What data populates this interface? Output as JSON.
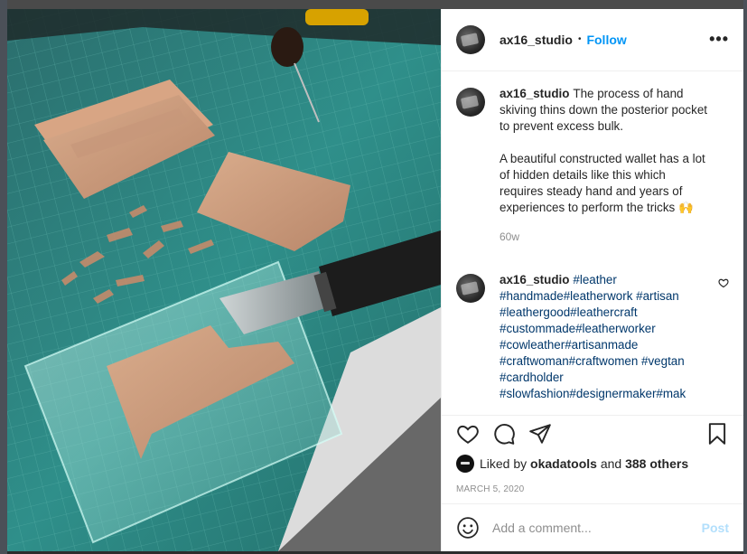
{
  "post": {
    "username": "ax16_studio",
    "follow_label": "Follow",
    "more_label": "•••",
    "caption": {
      "username": "ax16_studio",
      "text": "The process of hand skiving thins down the posterior pocket to prevent excess bulk.\n\nA beautiful constructed wallet has a lot of hidden details like this which requires steady hand and years of experiences to perform the tricks 🙌",
      "time": "60w"
    },
    "comment": {
      "username": "ax16_studio",
      "text": "#leather #handmade#leatherwork #artisan #leathergood#leathercraft #custommade#leatherworker #cowleather#artisanmade #craftwoman#craftwomen #vegtan #cardholder #slowfashion#designermaker#mak"
    },
    "likes": {
      "prefix": "Liked by",
      "user": "okadatools",
      "and": "and",
      "others": "388 others"
    },
    "date": "MARCH 5, 2020",
    "add_comment": {
      "placeholder": "Add a comment...",
      "post_label": "Post"
    }
  },
  "colors": {
    "follow": "#0095f6",
    "post_disabled": "#b2dffc",
    "muted": "#8e8e8e",
    "hashtag": "#00376b",
    "mat": "#2f8a86"
  },
  "icons": [
    "more-icon",
    "heart-icon",
    "comment-icon",
    "share-icon",
    "bookmark-icon",
    "smiley-icon",
    "heart-small-icon"
  ]
}
